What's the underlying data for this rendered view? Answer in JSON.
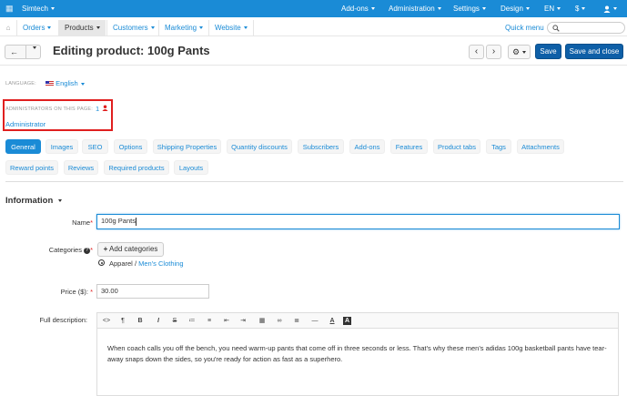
{
  "topbar": {
    "store": "Simtech",
    "menus": [
      "Add-ons",
      "Administration",
      "Settings",
      "Design",
      "EN",
      "$"
    ],
    "user_icon": "user-icon",
    "bg": "#1a8bd6"
  },
  "nav": {
    "items": [
      "Orders",
      "Products",
      "Customers",
      "Marketing",
      "Website"
    ],
    "active": "Products",
    "quick_menu": "Quick menu",
    "search_placeholder": ""
  },
  "titlebar": {
    "back_icon": "arrow-left-icon",
    "title": "Editing product: 100g Pants",
    "prev_icon": "chevron-left-icon",
    "next_icon": "chevron-right-icon",
    "gear_icon": "gear-icon",
    "save": "Save",
    "save_close": "Save and close"
  },
  "language": {
    "label": "LANGUAGE:",
    "value": "English"
  },
  "admins": {
    "label": "ADMINISTRATORS ON THIS PAGE:",
    "count": "1",
    "name": "Administrator"
  },
  "tabs_row1": [
    "General",
    "Images",
    "SEO",
    "Options",
    "Shipping Properties",
    "Quantity discounts",
    "Subscribers",
    "Add-ons",
    "Features",
    "Product tabs",
    "Tags",
    "Attachments"
  ],
  "tabs_row2": [
    "Reward points",
    "Reviews",
    "Required products",
    "Layouts"
  ],
  "section": {
    "title": "Information"
  },
  "form": {
    "name_label": "Name",
    "name_value": "100g Pants",
    "categories_label": "Categories",
    "add_categories": "Add categories",
    "category_parent": "Apparel",
    "category_sep": "/",
    "category_child": "Men's Clothing",
    "price_label": "Price ($):",
    "price_value": "30.00",
    "desc_label": "Full description:",
    "description": "When coach calls you off the bench, you need warm-up pants that come off in three seconds or less. That's why these men's adidas 100g basketball pants have tear-away snaps down the sides, so you're ready for action as fast as a superhero."
  },
  "toolbar_icons": [
    "code-view-icon",
    "paragraph-icon",
    "bold-icon",
    "italic-icon",
    "strikethrough-icon",
    "unordered-list-icon",
    "ordered-list-icon",
    "outdent-icon",
    "indent-icon",
    "table-icon",
    "link-icon",
    "align-icon",
    "horizontal-rule-icon",
    "font-color-icon",
    "background-color-icon"
  ],
  "toolbar_glyphs": [
    "<>",
    "¶",
    "B",
    "I",
    "S",
    "≔",
    "≡",
    "⇤",
    "⇥",
    "▦",
    "∞",
    "≣",
    "—",
    "A",
    "A"
  ]
}
